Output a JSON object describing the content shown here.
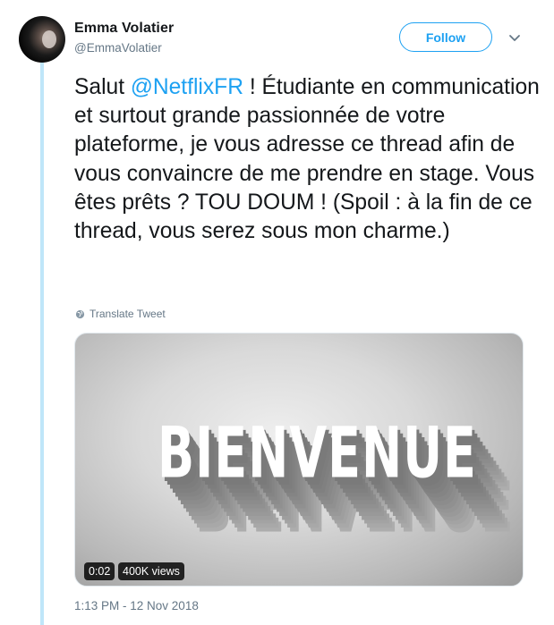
{
  "author": {
    "name": "Emma Volatier",
    "handle": "@EmmaVolatier"
  },
  "follow_label": "Follow",
  "tweet": {
    "text_before": "Salut ",
    "mention": "@NetflixFR",
    "text_after": " ! Étudiante en communication et surtout grande passionnée de votre plateforme, je vous adresse ce thread afin de vous convaincre de me prendre en stage. Vous êtes prêts ? TOU DOUM ! (Spoil : à la fin de ce thread, vous serez sous mon charme.)"
  },
  "translate_label": "Translate Tweet",
  "media": {
    "title_text": "BIENVENUE",
    "duration": "0:02",
    "views": "400K views"
  },
  "timestamp": "1:13 PM - 12 Nov 2018",
  "colors": {
    "accent": "#1da1f2",
    "thread_line": "#bfe6f9",
    "secondary_text": "#657786"
  },
  "icons": {
    "caret": "chevron-down-icon",
    "translate": "globe-icon"
  }
}
